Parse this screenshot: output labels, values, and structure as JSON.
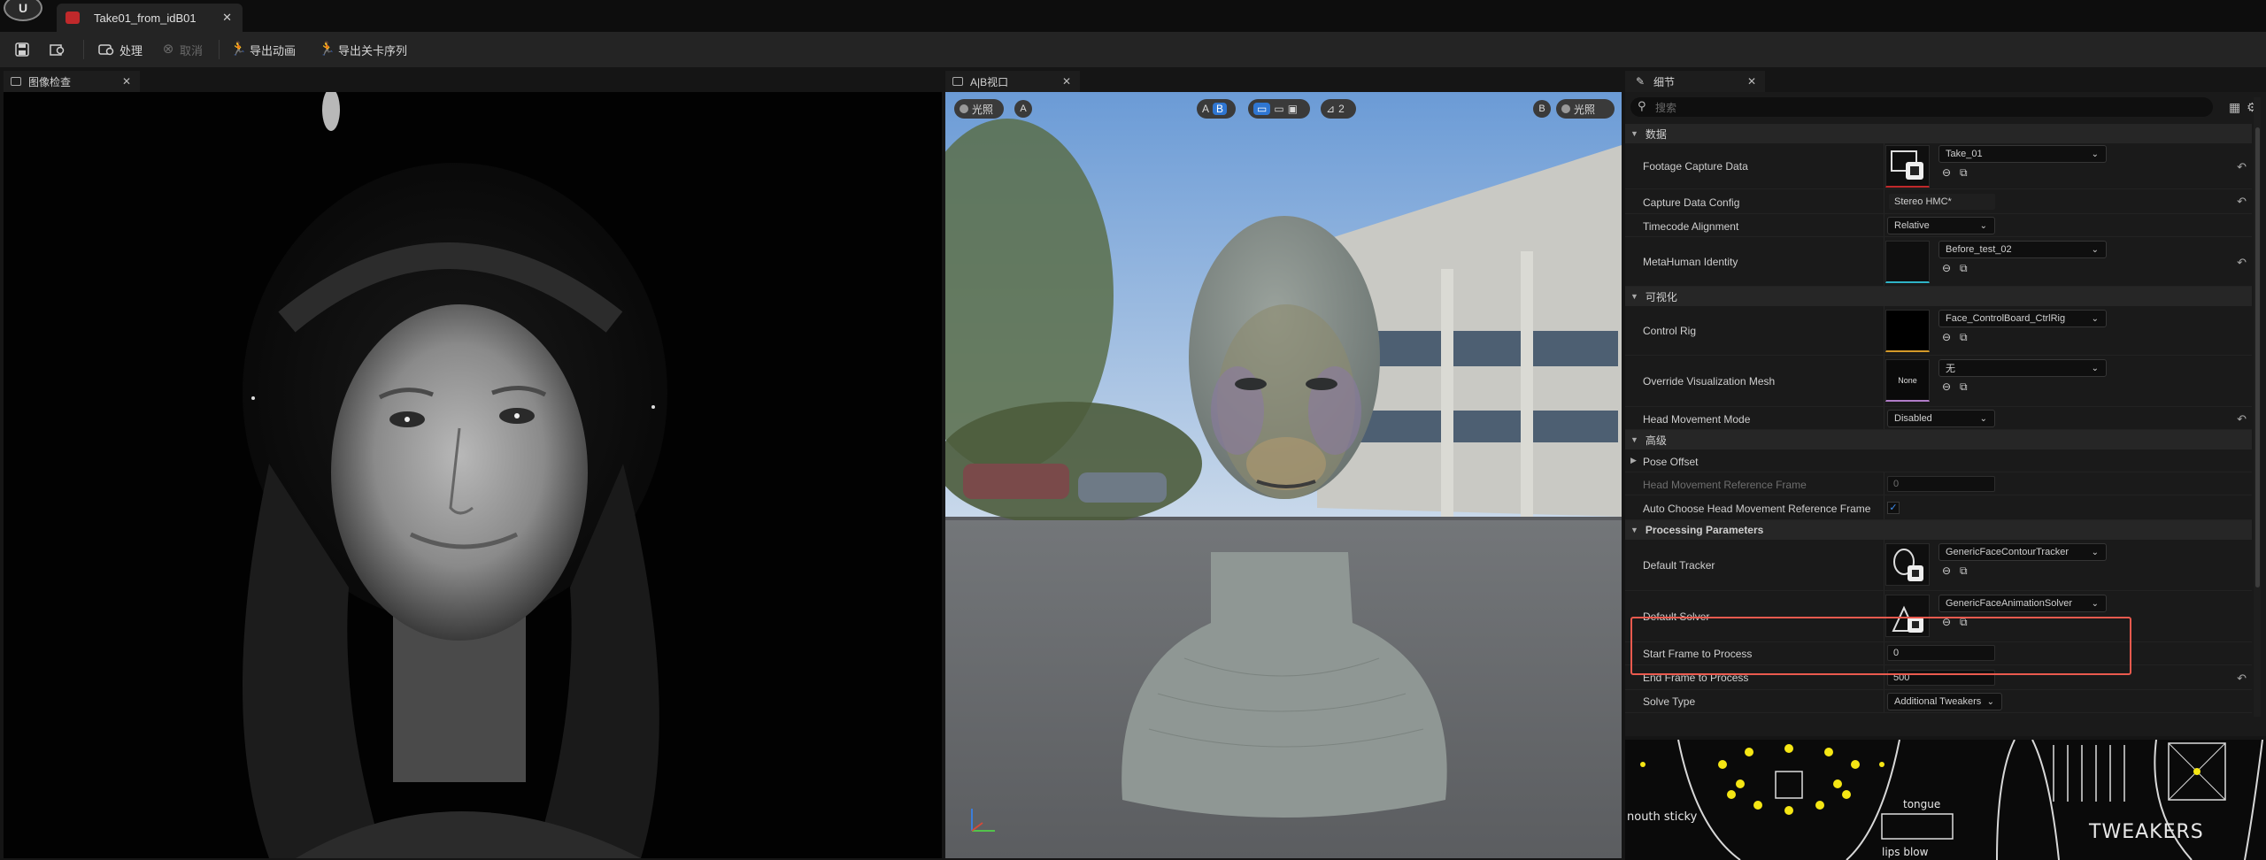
{
  "titlebar": {
    "doc_tab": "Take01_from_idB01",
    "close": "✕"
  },
  "toolbar": {
    "process_label": "处理",
    "cancel_label": "取消",
    "export_anim_label": "导出动画",
    "export_level_seq_label": "导出关卡序列"
  },
  "panels": {
    "image_review": {
      "title": "图像检查",
      "close": "✕"
    },
    "ab_viewport": {
      "title": "A|B视口",
      "close": "✕"
    },
    "details": {
      "title": "细节",
      "close": "✕"
    }
  },
  "viewport": {
    "lighting_a": "光照",
    "lighting_b": "光照",
    "a": "A",
    "b": "B",
    "a_toggle": "A",
    "b_toggle": "B",
    "count": "2"
  },
  "details": {
    "search_placeholder": "搜索",
    "sections": {
      "data": "数据",
      "visualization": "可视化",
      "advanced": "高级",
      "processing": "Processing Parameters"
    },
    "rows": {
      "footage_capture_data": {
        "label": "Footage Capture Data",
        "value": "Take_01"
      },
      "capture_data_config": {
        "label": "Capture Data Config",
        "value": "Stereo HMC*"
      },
      "timecode_alignment": {
        "label": "Timecode Alignment",
        "value": "Relative"
      },
      "metahuman_identity": {
        "label": "MetaHuman Identity",
        "value": "Before_test_02"
      },
      "control_rig": {
        "label": "Control Rig",
        "value": "Face_ControlBoard_CtrlRig"
      },
      "override_vis_mesh": {
        "label": "Override Visualization Mesh",
        "value": "无",
        "thumb_text": "None"
      },
      "head_movement_mode": {
        "label": "Head Movement Mode",
        "value": "Disabled"
      },
      "pose_offset": {
        "label": "Pose Offset"
      },
      "head_movement_ref_frame": {
        "label": "Head Movement Reference Frame",
        "value": "0"
      },
      "auto_choose_ref_frame": {
        "label": "Auto Choose Head Movement Reference Frame",
        "checked": "✓"
      },
      "default_tracker": {
        "label": "Default Tracker",
        "value": "GenericFaceContourTracker"
      },
      "default_solver": {
        "label": "Default Solver",
        "value": "GenericFaceAnimationSolver"
      },
      "start_frame": {
        "label": "Start Frame to Process",
        "value": "0"
      },
      "end_frame": {
        "label": "End Frame to Process",
        "value": "500"
      },
      "solve_type": {
        "label": "Solve Type",
        "value": "Additional Tweakers"
      }
    }
  },
  "control_board": {
    "mouth_sticky": "nouth sticky",
    "tongue": "tongue",
    "lips_blow": "lips blow",
    "tweakers": "TWEAKERS"
  },
  "colors": {
    "accent_blue": "#2f76d2",
    "highlight_red": "#ea5a4e",
    "footage_bar": "#c0292b",
    "identity_bar": "#2fb3c7",
    "rig_bar": "#d49a2a",
    "mesh_bar": "#b07cc8"
  }
}
